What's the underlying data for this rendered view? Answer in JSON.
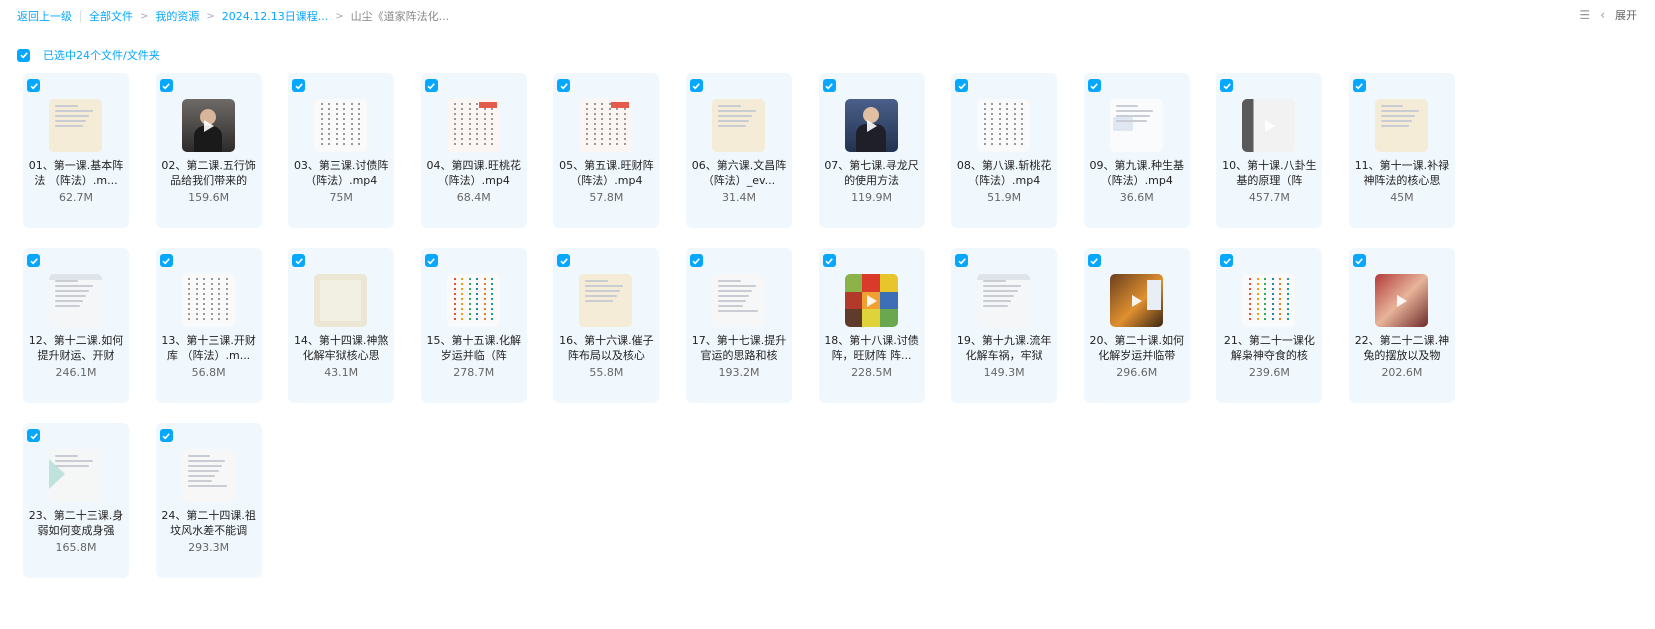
{
  "breadcrumb": {
    "back": "返回上一级",
    "items": [
      "全部文件",
      "我的资源",
      "2024.12.13日课程...",
      "山尘《道家阵法化..."
    ]
  },
  "toolbar": {
    "expand_label": "展开",
    "layout_icon": "list-view-icon",
    "collapse_icon": "chevron-left-icon"
  },
  "selection": {
    "text": "已选中24个文件/文件夹"
  },
  "colors": {
    "accent": "#06a7ff",
    "card_bg": "#f1f8fd"
  },
  "files": [
    {
      "name": "01、第一课.基本阵法 （阵法）.m...",
      "size": "62.7M"
    },
    {
      "name": "02、第二课.五行饰品给我们带来的",
      "size": "159.6M"
    },
    {
      "name": "03、第三课.讨债阵 （阵法）.mp4",
      "size": "75M"
    },
    {
      "name": "04、第四课.旺桃花（阵法）.mp4",
      "size": "68.4M"
    },
    {
      "name": "05、第五课.旺财阵 （阵法）.mp4",
      "size": "57.8M"
    },
    {
      "name": "06、第六课.文昌阵 （阵法）_ev...",
      "size": "31.4M"
    },
    {
      "name": "07、第七课.寻龙尺的使用方法",
      "size": "119.9M"
    },
    {
      "name": "08、第八课.斩桃花 （阵法）.mp4",
      "size": "51.9M"
    },
    {
      "name": "09、第九课.种生基（阵法）.mp4",
      "size": "36.6M"
    },
    {
      "name": "10、第十课.八卦生基的原理（阵",
      "size": "457.7M"
    },
    {
      "name": "11、第十一课.补禄神阵法的核心思",
      "size": "45M"
    },
    {
      "name": "12、第十二课.如何提升财运、开财",
      "size": "246.1M"
    },
    {
      "name": "13、第十三课.开财库 （阵法）.m...",
      "size": "56.8M"
    },
    {
      "name": "14、第十四课.神煞化解牢狱核心思",
      "size": "43.1M"
    },
    {
      "name": "15、第十五课.化解岁运并临（阵",
      "size": "278.7M"
    },
    {
      "name": "16、第十六课.催子阵布局以及核心",
      "size": "55.8M"
    },
    {
      "name": "17、第十七课.提升官运的思路和核",
      "size": "193.2M"
    },
    {
      "name": "18、第十八课.讨债阵，旺财阵 阵...",
      "size": "228.5M"
    },
    {
      "name": "19、第十九课.流年化解车祸，牢狱",
      "size": "149.3M"
    },
    {
      "name": "20、第二十课.如何化解岁运并临带",
      "size": "296.6M"
    },
    {
      "name": "21、第二十一课化解枭神夺食的核",
      "size": "239.6M"
    },
    {
      "name": "22、第二十二课.神兔的摆放以及物",
      "size": "202.6M"
    },
    {
      "name": "23、第二十三课.身弱如何变成身强",
      "size": "165.8M"
    },
    {
      "name": "24、第二十四课.祖坟风水差不能调",
      "size": "293.3M"
    }
  ]
}
